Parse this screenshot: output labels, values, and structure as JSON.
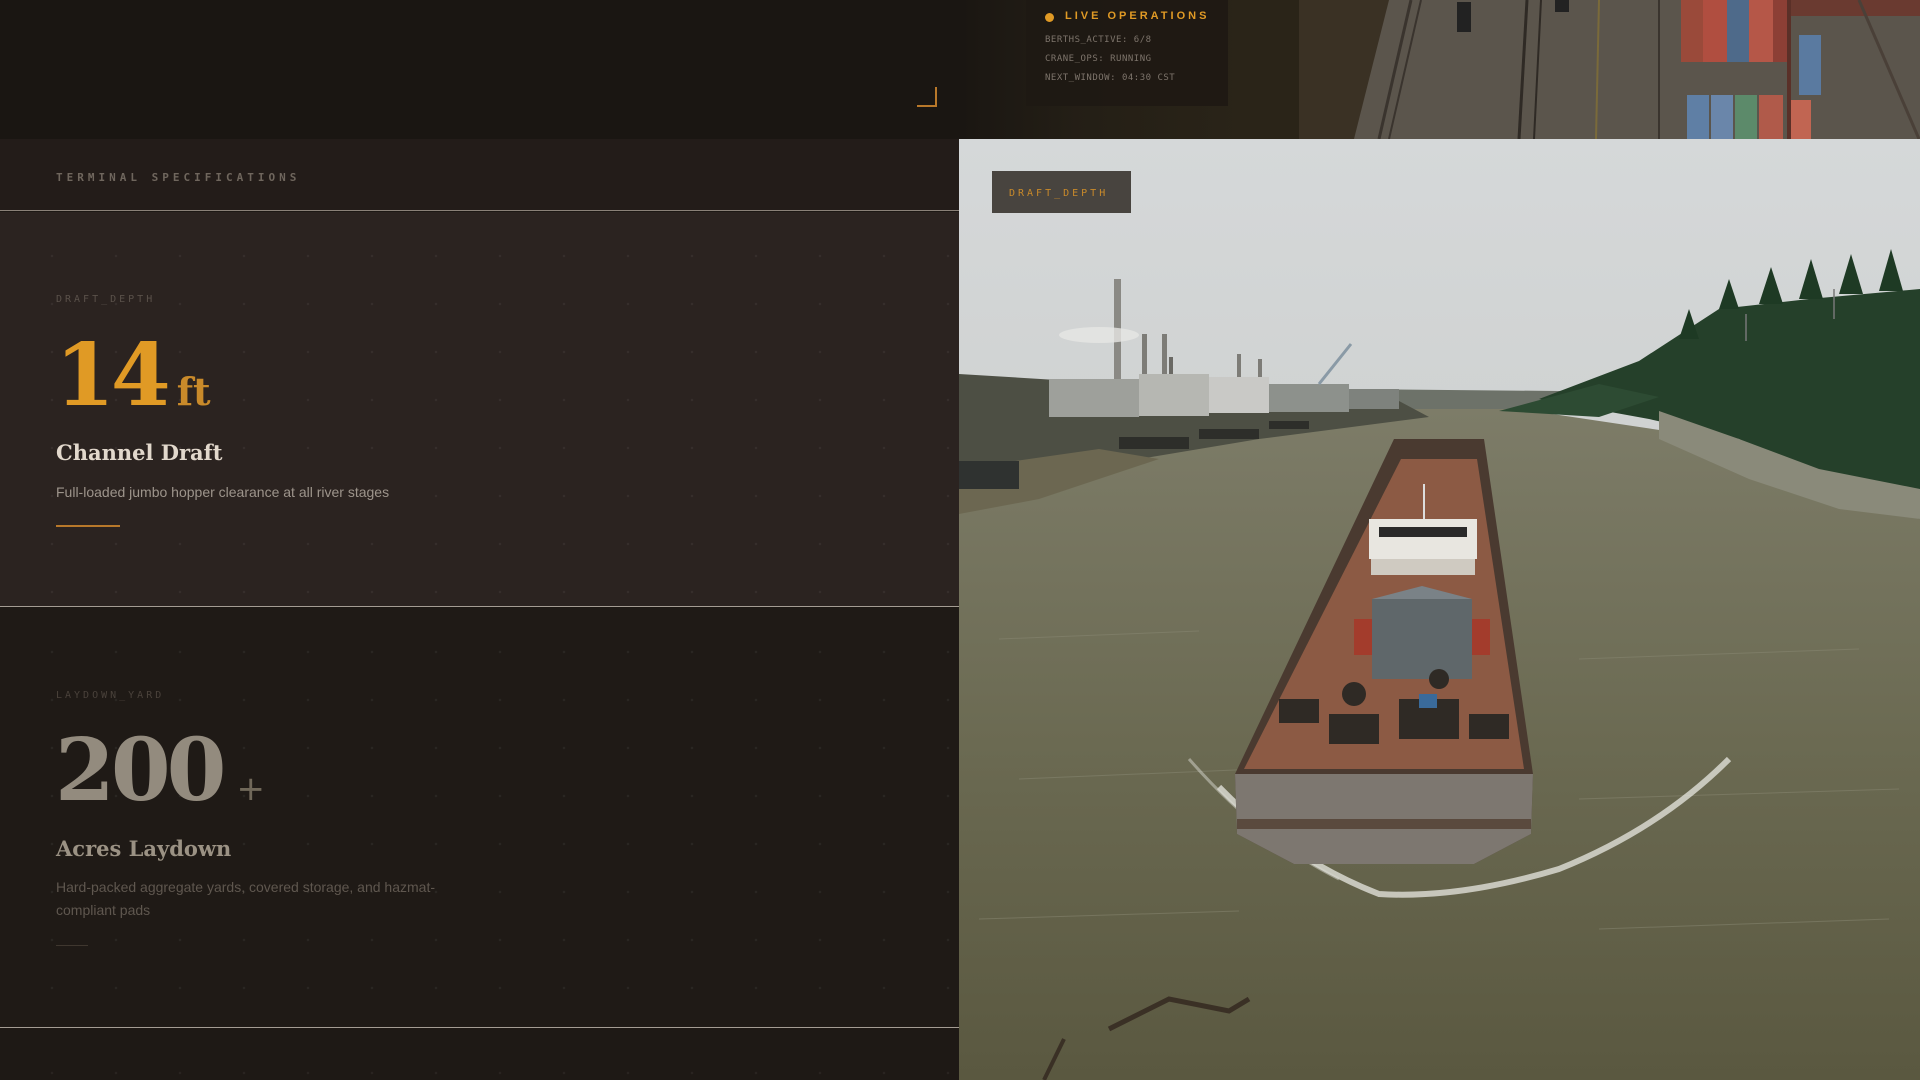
{
  "live_ops": {
    "title": "LIVE OPERATIONS",
    "lines": [
      "BERTHS_ACTIVE: 6/8",
      "CRANE_OPS: RUNNING",
      "NEXT_WINDOW: 04:30 CST"
    ]
  },
  "specs": {
    "header": "TERMINAL SPECIFICATIONS",
    "cards": [
      {
        "tag": "DRAFT_DEPTH",
        "value": "14",
        "unit": "ft",
        "title": "Channel Draft",
        "description": "Full-loaded jumbo hopper clearance at all river stages"
      },
      {
        "tag": "LAYDOWN_YARD",
        "value": "200",
        "unit": "+",
        "title": "Acres Laydown",
        "description": "Hard-packed aggregate yards, covered storage, and hazmat-compliant pads"
      }
    ]
  },
  "image_badge": "DRAFT_DEPTH",
  "colors": {
    "accent": "#e09a25",
    "background": "#1d1814",
    "card_active": "#2b2320"
  }
}
